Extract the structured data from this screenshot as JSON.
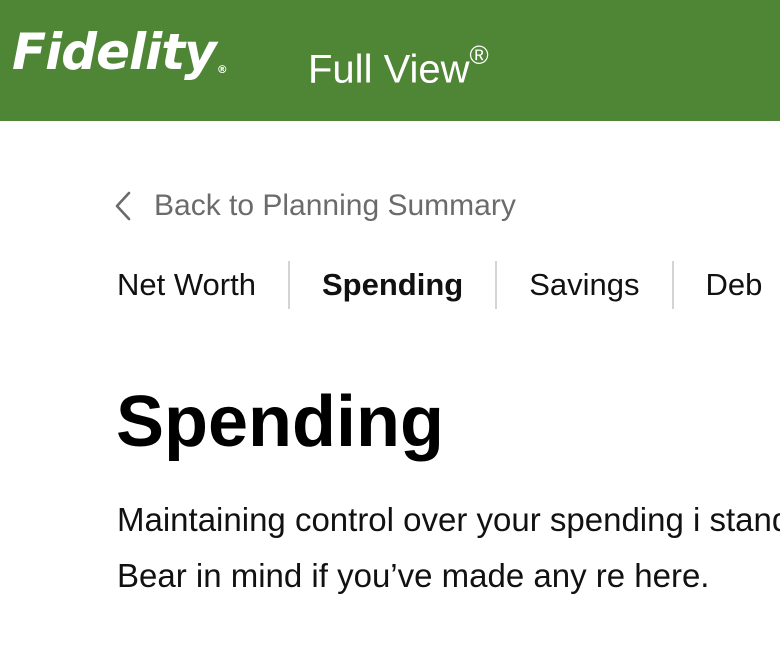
{
  "header": {
    "brand": "Fidelity",
    "brand_mark": "®",
    "product": "Full View",
    "product_mark": "®",
    "background_color": "#4e8636"
  },
  "back_link": {
    "icon": "chevron-left-icon",
    "label": "Back to Planning Summary"
  },
  "tabs": [
    {
      "label": "Net Worth",
      "active": false
    },
    {
      "label": "Spending",
      "active": true
    },
    {
      "label": "Savings",
      "active": false
    },
    {
      "label": "Deb",
      "active": false
    }
  ],
  "main": {
    "title": "Spending",
    "intro": "Maintaining control over your spending i stand. Bear in mind if you’ve made any re here."
  }
}
